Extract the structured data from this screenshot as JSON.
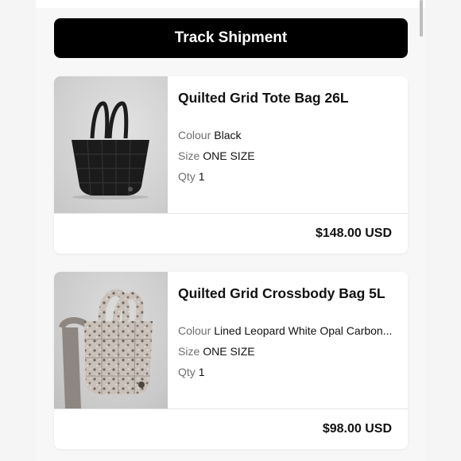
{
  "track_button": {
    "label": "Track Shipment"
  },
  "items": [
    {
      "name": "Quilted Grid Tote Bag 26L",
      "colour_label": "Colour",
      "colour": "Black",
      "size_label": "Size",
      "size": "ONE SIZE",
      "qty_label": "Qty",
      "qty": "1",
      "price": "$148.00 USD",
      "bag_color": "#1a1a1a"
    },
    {
      "name": "Quilted Grid Crossbody Bag 5L",
      "colour_label": "Colour",
      "colour": "Lined Leopard White Opal Carbon...",
      "size_label": "Size",
      "size": "ONE SIZE",
      "qty_label": "Qty",
      "qty": "1",
      "price": "$98.00 USD",
      "bag_color": "#b9b1aa"
    }
  ]
}
